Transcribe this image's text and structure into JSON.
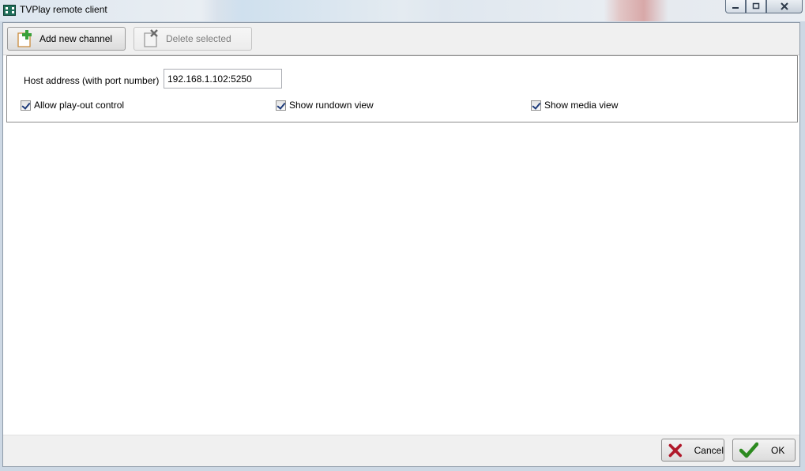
{
  "window": {
    "title": "TVPlay remote client",
    "controls": {
      "minimize": "minimize-icon",
      "maximize": "maximize-icon",
      "close": "close-icon"
    }
  },
  "toolbar": {
    "add_label": "Add new channel",
    "add_icon": "add-channel-icon",
    "delete_label": "Delete selected",
    "delete_icon": "delete-channel-icon",
    "delete_enabled": false
  },
  "channel": {
    "host_label": "Host address (with port number)",
    "host_value": "192.168.1.102:5250",
    "allow_playout_label": "Allow play-out control",
    "allow_playout_checked": true,
    "show_rundown_label": "Show rundown view",
    "show_rundown_checked": true,
    "show_media_label": "Show media view",
    "show_media_checked": true
  },
  "footer": {
    "cancel_label": "Cancel",
    "cancel_icon": "cancel-x-icon",
    "ok_label": "OK",
    "ok_icon": "ok-check-icon"
  },
  "colors": {
    "cancel_icon": "#b0182a",
    "ok_icon": "#2c8a1f",
    "add_icon": "#3aa13a"
  }
}
